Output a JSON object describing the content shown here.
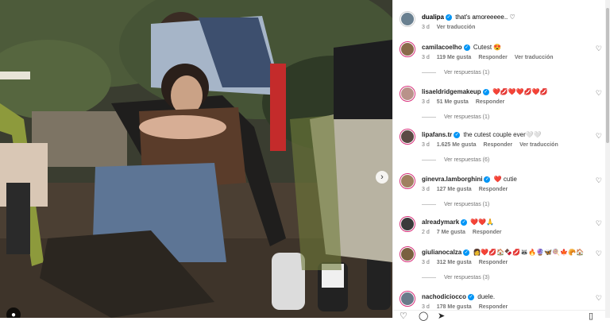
{
  "post": {
    "author": "dualipa",
    "caption": "that's amoreeeee.. ♡",
    "time": "3 d",
    "translate": "Ver traducción",
    "next_icon": "chevron-right-icon",
    "tag_icon": "person-icon"
  },
  "comments": [
    {
      "user": "camilacoelho",
      "text": "Cutest 😍",
      "time": "3 d",
      "likes": "119 Me gusta",
      "reply": "Responder",
      "translate": "Ver traducción",
      "replies": "Ver respuestas (1)",
      "avatar_color": "#8a6a4a"
    },
    {
      "user": "lisaeldridgemakeup",
      "text": "❤️💋❤️❤️💋❤️💋",
      "time": "3 d",
      "likes": "51 Me gusta",
      "reply": "Responder",
      "translate": "",
      "replies": "Ver respuestas (1)",
      "avatar_color": "#b9928a"
    },
    {
      "user": "lipafans.tr",
      "text": "the cutest couple ever🤍🤍",
      "time": "3 d",
      "likes": "1.625 Me gusta",
      "reply": "Responder",
      "translate": "Ver traducción",
      "replies": "Ver respuestas (6)",
      "avatar_color": "#5a4a44"
    },
    {
      "user": "ginevra.lamborghini",
      "text": "❤️ cutie",
      "time": "3 d",
      "likes": "127 Me gusta",
      "reply": "Responder",
      "translate": "",
      "replies": "Ver respuestas (1)",
      "avatar_color": "#a08060"
    },
    {
      "user": "alreadymark",
      "text": "❤️❤️🙏",
      "time": "2 d",
      "likes": "7 Me gusta",
      "reply": "Responder",
      "translate": "",
      "replies": "",
      "avatar_color": "#3a3a3a"
    },
    {
      "user": "giulianocalza",
      "text": "👩‍❤️‍💋🏠🍫💋🦝🔥🔮🦋🍭🍁🥐🏠",
      "time": "3 d",
      "likes": "312 Me gusta",
      "reply": "Responder",
      "translate": "",
      "replies": "Ver respuestas (3)",
      "avatar_color": "#7a6040"
    },
    {
      "user": "nachodiciocco",
      "text": "duele.",
      "time": "3 d",
      "likes": "178 Me gusta",
      "reply": "Responder",
      "translate": "",
      "replies": "",
      "avatar_color": "#6a7a8a"
    }
  ],
  "actions": {
    "like_icon": "heart-icon",
    "comment_icon": "comment-icon",
    "share_icon": "share-icon",
    "save_icon": "bookmark-icon"
  },
  "colors": {
    "verified": "#0095f6",
    "accent_ring": "#d62976",
    "liked": "#ed4956"
  }
}
